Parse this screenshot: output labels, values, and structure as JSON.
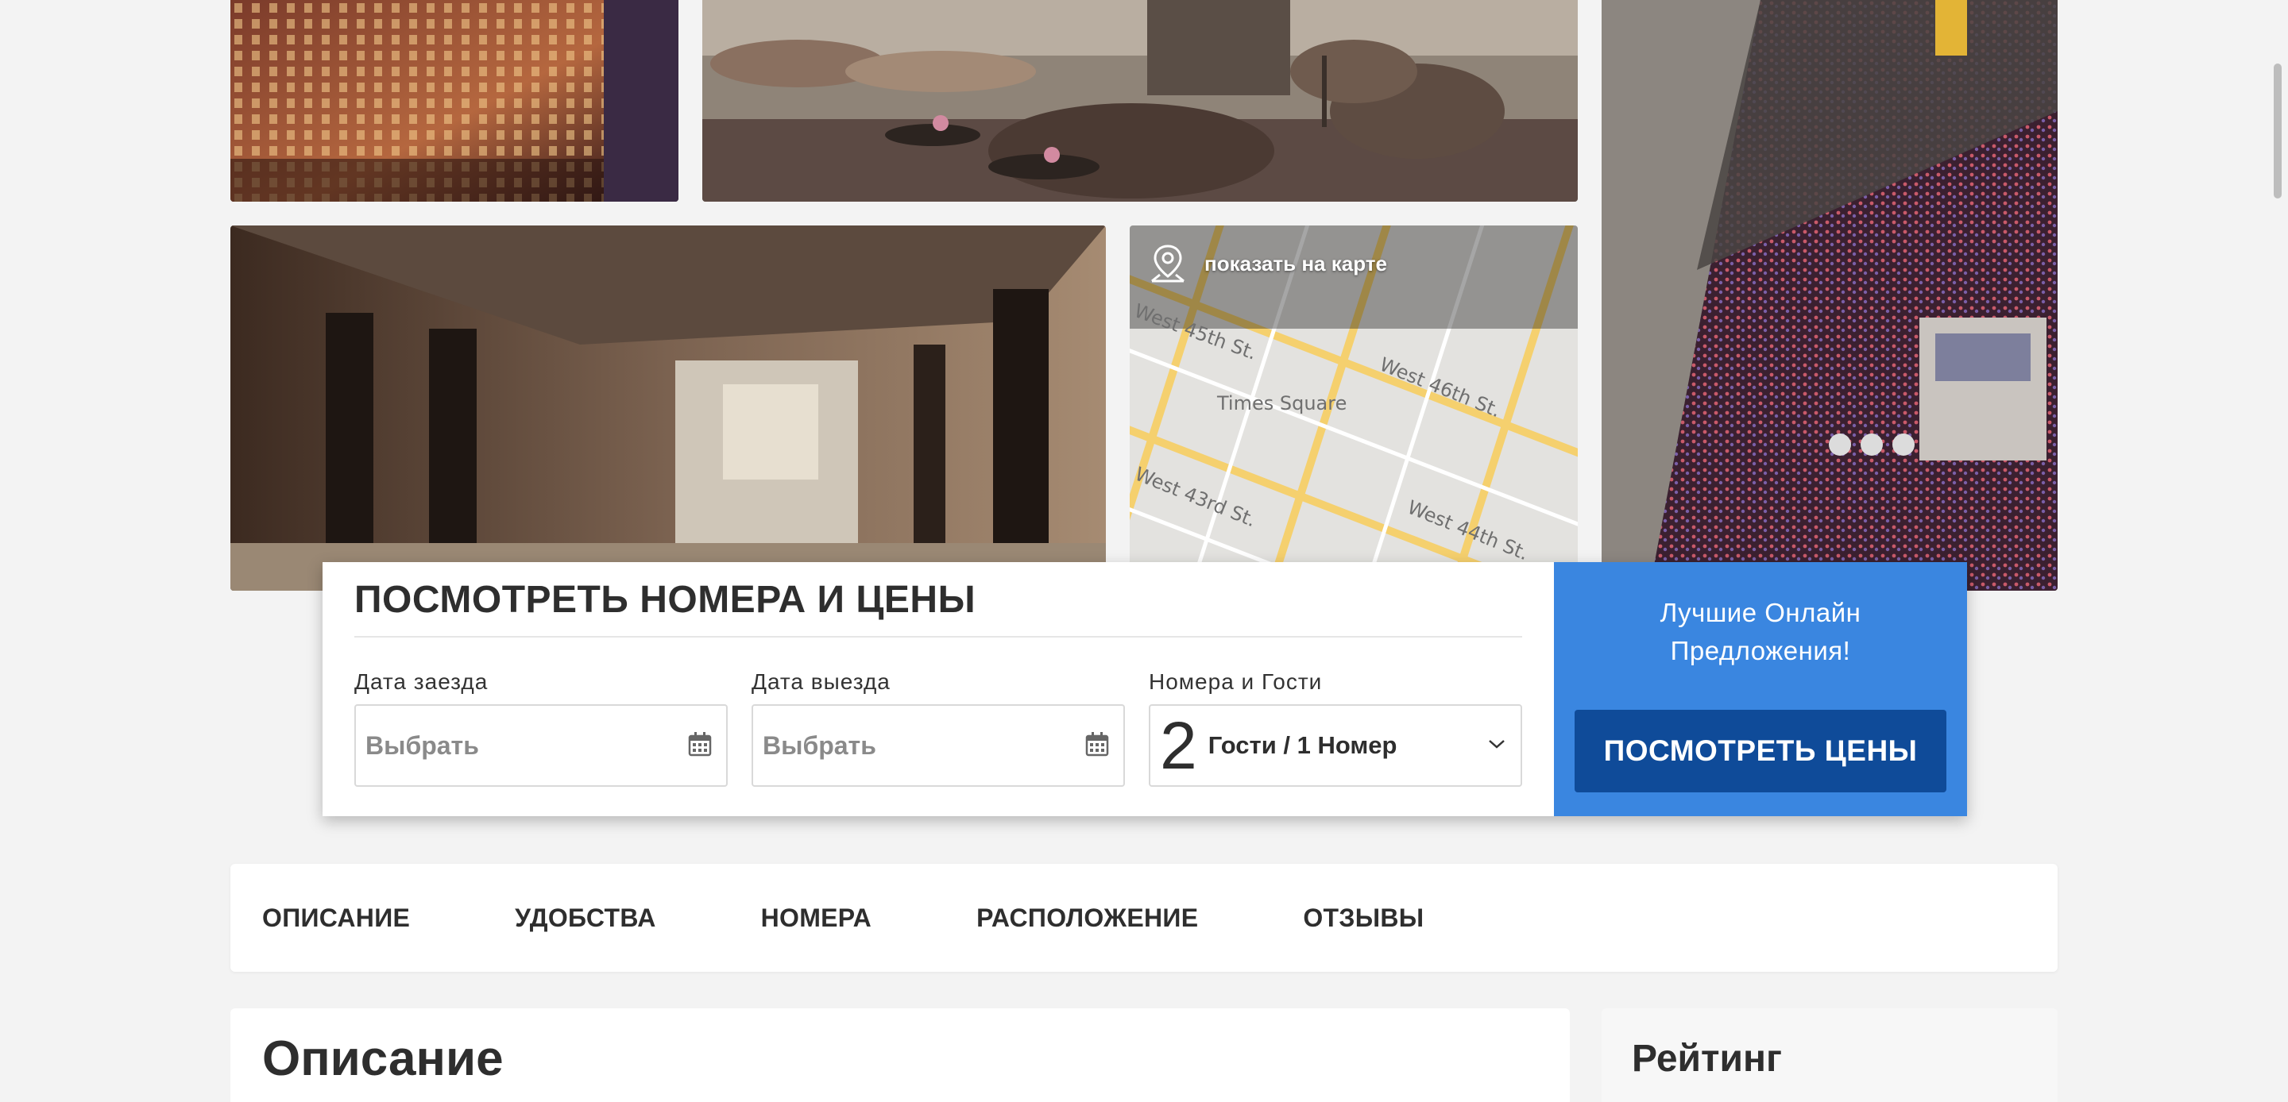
{
  "gallery": {
    "map_link_label": "показать на карте",
    "map_streets": [
      "West 45th St.",
      "West 46th St.",
      "Times Square",
      "West 43rd St.",
      "West 44th St."
    ]
  },
  "booking": {
    "title": "ПОСМОТРЕТЬ НОМЕРА И ЦЕНЫ",
    "checkin_label": "Дата заезда",
    "checkin_placeholder": "Выбрать",
    "checkout_label": "Дата выезда",
    "checkout_placeholder": "Выбрать",
    "guests_label": "Номера и Гости",
    "guests_count": "2",
    "guests_text": "Гости / 1 Номер",
    "promo_text": "Лучшие Онлайн Предложения!",
    "prices_button": "ПОСМОТРЕТЬ ЦЕНЫ"
  },
  "nav": {
    "tabs": [
      "ОПИСАНИЕ",
      "УДОБСТВА",
      "НОМЕРА",
      "РАСПОЛОЖЕНИЕ",
      "ОТЗЫВЫ"
    ]
  },
  "description": {
    "title": "Описание"
  },
  "rating": {
    "title": "Рейтинг"
  },
  "colors": {
    "accent": "#3a86e0",
    "button": "#0f4b99",
    "background": "#f3f3f3"
  }
}
